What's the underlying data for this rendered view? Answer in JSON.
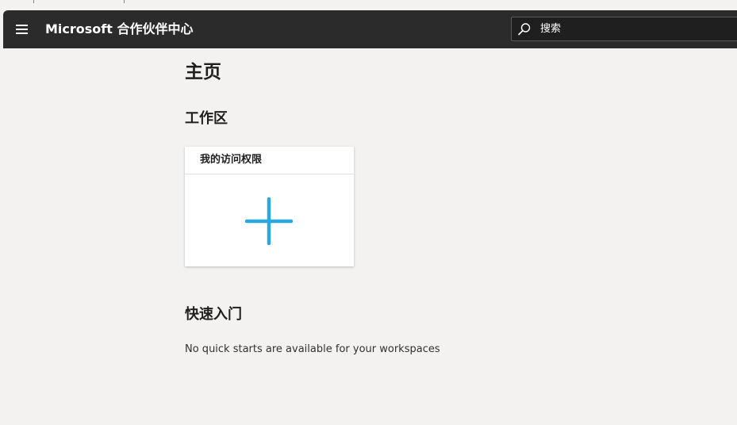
{
  "header": {
    "menu_icon": "hamburger-menu-icon",
    "app_title": "Microsoft 合作伙伴中心",
    "search": {
      "icon": "search-icon",
      "placeholder": "搜索"
    }
  },
  "main": {
    "page_title": "主页",
    "workspaces": {
      "title": "工作区",
      "tiles": [
        {
          "label": "我的访问权限",
          "icon": "plus-icon"
        }
      ]
    },
    "quick_starts": {
      "title": "快速入门",
      "empty_message": "No quick starts are available for your workspaces"
    }
  },
  "colors": {
    "header_bg": "#2b2b2b",
    "page_bg": "#f3f2f1",
    "accent_plus": "#28a8e0",
    "tile_bg": "#ffffff",
    "text": "#201f1e"
  }
}
